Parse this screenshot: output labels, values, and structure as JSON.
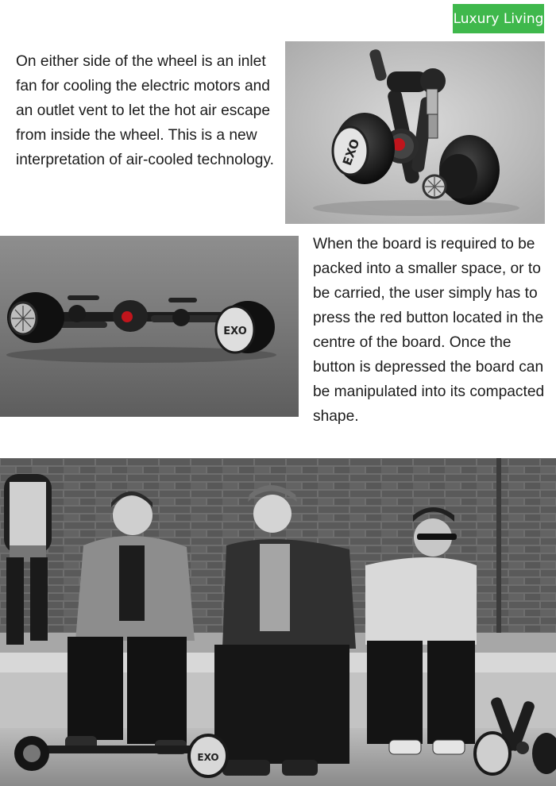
{
  "header": {
    "section_badge": "Luxury Living",
    "badge_color": "#3fb84c"
  },
  "paragraphs": [
    "On either side of the wheel is an inlet fan for cooling the electric motors and an outlet vent to let the hot air escape from inside the wheel. This is a new interpretation of air-cooled technology.",
    "When the board is required to be packed into a smaller space, or to be carried, the user simply has to press the red button located in the centre of the board. Once the button is depressed the board can be manipulated into its compacted shape."
  ],
  "images": {
    "folded_board": {
      "logo": "EXO"
    },
    "flat_board": {
      "logo": "EXO"
    },
    "group_photo": {
      "board_logo": "EXO"
    }
  },
  "colors": {
    "text": "#1c1c1c",
    "accent_red": "#c0151c"
  }
}
